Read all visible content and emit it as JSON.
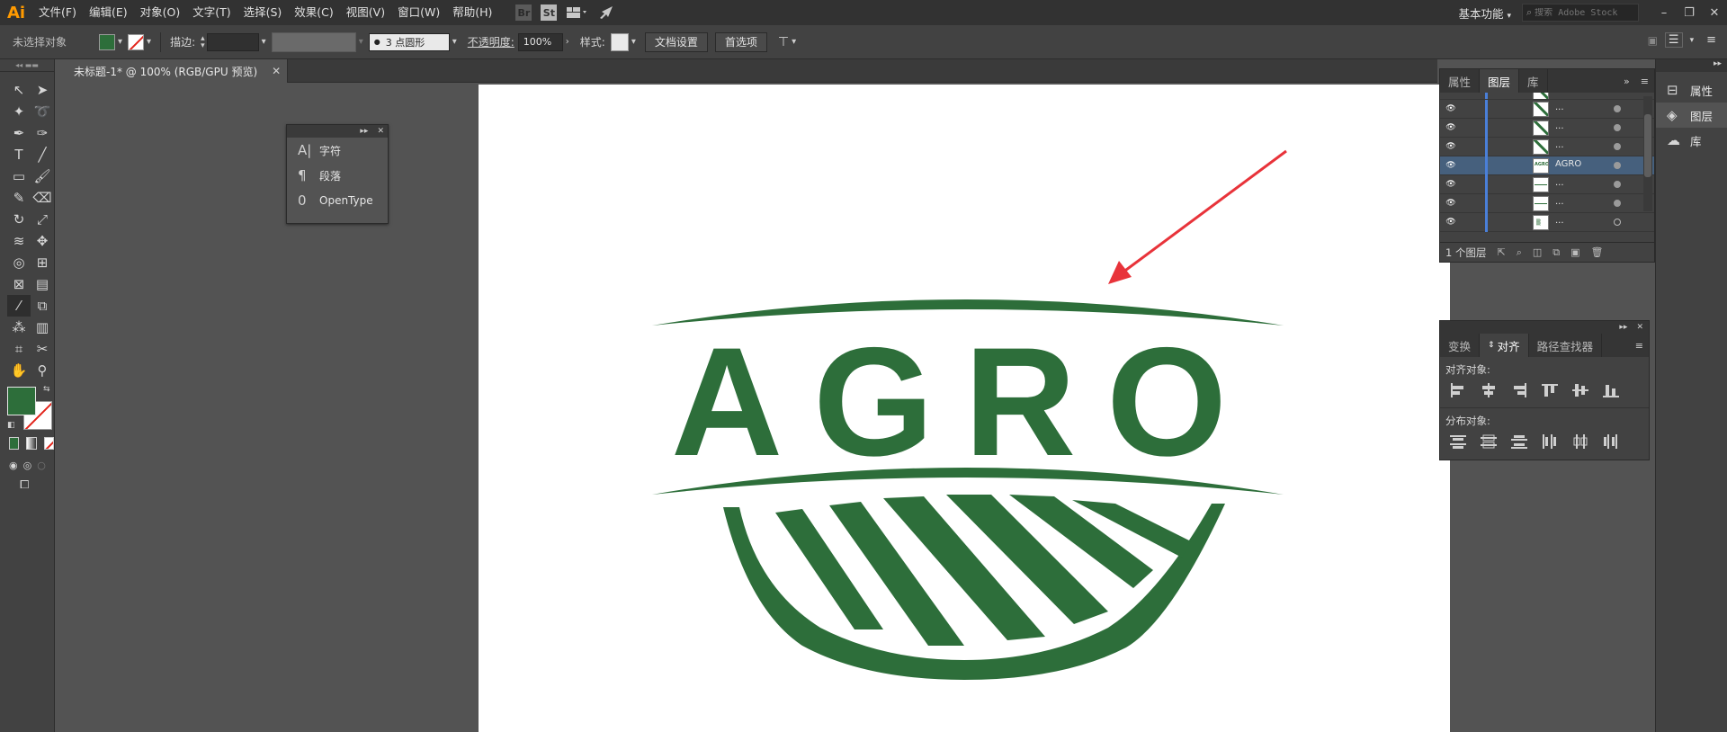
{
  "app": {
    "logo": "Ai"
  },
  "menu": {
    "items": [
      "文件(F)",
      "编辑(E)",
      "对象(O)",
      "文字(T)",
      "选择(S)",
      "效果(C)",
      "视图(V)",
      "窗口(W)",
      "帮助(H)"
    ],
    "bridge_label": "Br",
    "stock_label": "St",
    "workspace": "基本功能",
    "stock_search_placeholder": "搜索 Adobe Stock"
  },
  "controlbar": {
    "selection_status": "未选择对象",
    "stroke_label": "描边:",
    "brush_value": "3 点圆形",
    "opacity_label": "不透明度:",
    "opacity_value": "100%",
    "style_label": "样式:",
    "doc_setup_label": "文档设置",
    "preferences_label": "首选项",
    "fill_color": "#2d6e3a",
    "stroke_color": "#ffffff"
  },
  "document": {
    "tab_title": "未标题-1* @ 100% (RGB/GPU 预览)",
    "logo_text": "AGRO",
    "logo_color": "#2d6e3a",
    "arrow_color": "#e8333a"
  },
  "type_panel": {
    "items": [
      {
        "label": "字符",
        "icon": "character-icon"
      },
      {
        "label": "段落",
        "icon": "paragraph-icon"
      },
      {
        "label": "OpenType",
        "icon": "opentype-icon"
      }
    ]
  },
  "layers_panel": {
    "tabs": [
      "属性",
      "图层",
      "库"
    ],
    "active_tab": "图层",
    "rows": [
      {
        "name": "...",
        "thumb": "stripe",
        "selected": false
      },
      {
        "name": "...",
        "thumb": "stripe",
        "selected": false
      },
      {
        "name": "...",
        "thumb": "stripe",
        "selected": false
      },
      {
        "name": "AGRO",
        "thumb": "text",
        "selected": true
      },
      {
        "name": "...",
        "thumb": "line",
        "selected": false
      },
      {
        "name": "...",
        "thumb": "line",
        "selected": false
      },
      {
        "name": "...",
        "thumb": "blank",
        "selected": false
      }
    ],
    "footer_count": "1 个图层"
  },
  "align_panel": {
    "tabs": [
      "变换",
      "对齐",
      "路径查找器"
    ],
    "active_tab": "对齐",
    "align_objects_label": "对齐对象:",
    "distribute_objects_label": "分布对象:"
  },
  "dock": {
    "items": [
      {
        "label": "属性",
        "icon": "properties-icon"
      },
      {
        "label": "图层",
        "icon": "layers-icon"
      },
      {
        "label": "库",
        "icon": "libraries-icon"
      }
    ]
  }
}
